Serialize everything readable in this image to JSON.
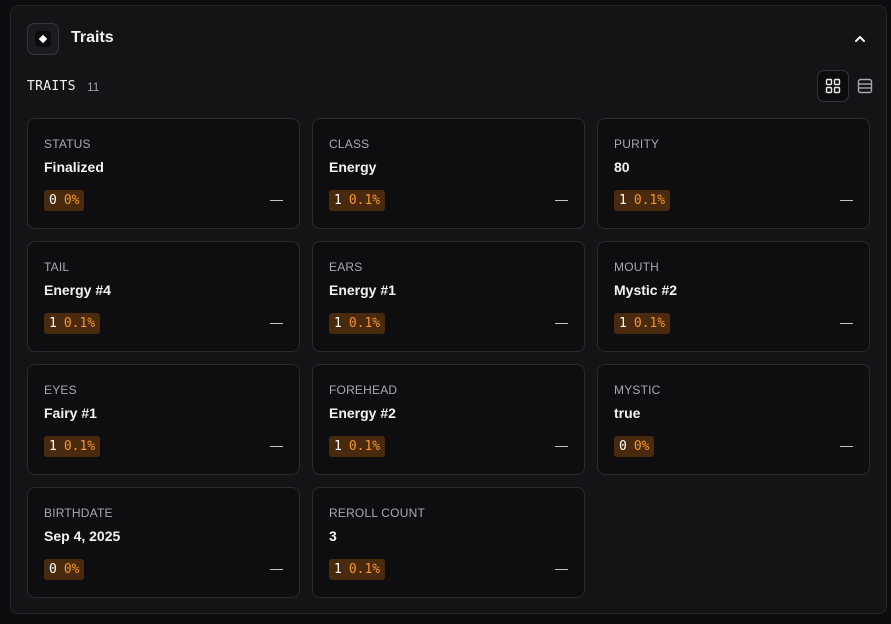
{
  "header": {
    "title": "Traits",
    "icon": "diamond-icon",
    "collapse_icon": "chevron-up-icon"
  },
  "traits_section": {
    "label": "TRAITS",
    "count": "11",
    "grid_view_icon": "grid-view-icon",
    "list_view_icon": "list-view-icon"
  },
  "colors": {
    "badge_bg": "#4a2a0e",
    "badge_percent": "#f5962a",
    "card_bg": "#0e0e11",
    "panel_bg": "#141417"
  },
  "traits": [
    {
      "label": "STATUS",
      "value": "Finalized",
      "count": "0",
      "percent": "0%",
      "change": "—"
    },
    {
      "label": "CLASS",
      "value": "Energy",
      "count": "1",
      "percent": "0.1%",
      "change": "—"
    },
    {
      "label": "PURITY",
      "value": "80",
      "count": "1",
      "percent": "0.1%",
      "change": "—"
    },
    {
      "label": "TAIL",
      "value": "Energy #4",
      "count": "1",
      "percent": "0.1%",
      "change": "—"
    },
    {
      "label": "EARS",
      "value": "Energy #1",
      "count": "1",
      "percent": "0.1%",
      "change": "—"
    },
    {
      "label": "MOUTH",
      "value": "Mystic #2",
      "count": "1",
      "percent": "0.1%",
      "change": "—"
    },
    {
      "label": "EYES",
      "value": "Fairy #1",
      "count": "1",
      "percent": "0.1%",
      "change": "—"
    },
    {
      "label": "FOREHEAD",
      "value": "Energy #2",
      "count": "1",
      "percent": "0.1%",
      "change": "—"
    },
    {
      "label": "MYSTIC",
      "value": "true",
      "count": "0",
      "percent": "0%",
      "change": "—"
    },
    {
      "label": "BIRTHDATE",
      "value": "Sep 4, 2025",
      "count": "0",
      "percent": "0%",
      "change": "—"
    },
    {
      "label": "REROLL COUNT",
      "value": "3",
      "count": "1",
      "percent": "0.1%",
      "change": "—"
    }
  ]
}
